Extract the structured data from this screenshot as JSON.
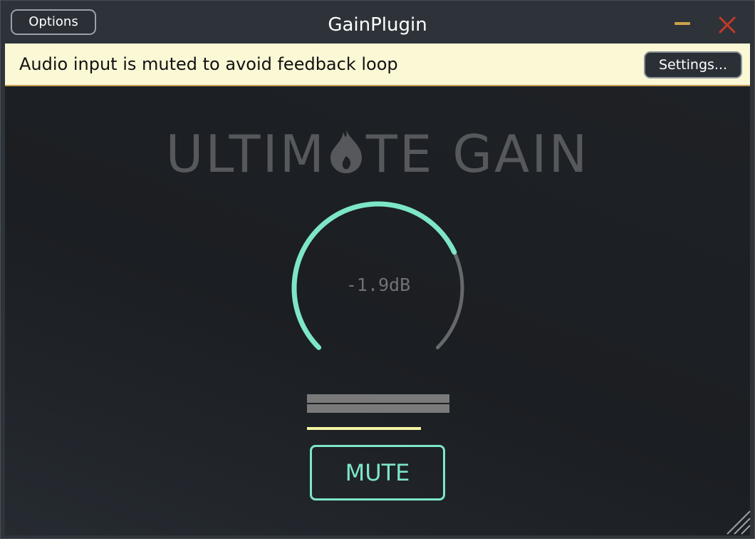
{
  "window": {
    "title": "GainPlugin",
    "options_label": "Options",
    "minimize_icon": "minimize-icon",
    "close_icon": "close-icon"
  },
  "banner": {
    "message": "Audio input is muted to avoid feedback loop",
    "settings_label": "Settings..."
  },
  "plugin": {
    "logo_left": "ULTIM",
    "logo_right": "TE GAIN",
    "logo_icon": "flame-icon",
    "gain": {
      "value_label": "-1.9dB",
      "level_fraction": 0.74
    },
    "mute_label": "MUTE"
  },
  "colors": {
    "accent": "#7de6c8",
    "banner_bg": "#fbf8d6",
    "level_line": "#f3f5a3",
    "minimize": "#c9a24a",
    "close": "#c0392b"
  }
}
